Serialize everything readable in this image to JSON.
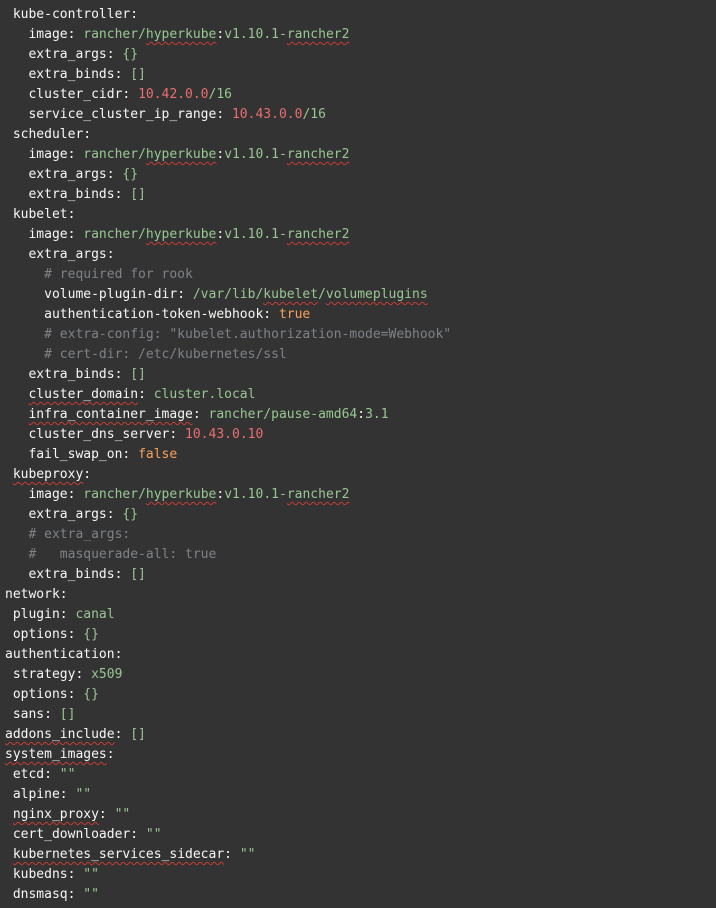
{
  "editor": {
    "language": "yaml",
    "content_description": "Rancher RKE cluster.yml services/network/authentication/system_images configuration",
    "colors": {
      "background": "#333333",
      "key_text": "#f7f7f5",
      "string_value": "#99C794",
      "number_value": "#EA6E71",
      "boolean_value": "#F9A15B",
      "comment": "#7E8288",
      "spellcheck_squiggle": "#c43c35"
    },
    "lines": [
      {
        "segments": [
          {
            "t": " kube-controller",
            "s": "key"
          },
          {
            "t": ":",
            "s": "pun"
          }
        ]
      },
      {
        "segments": [
          {
            "t": "   image",
            "s": "key"
          },
          {
            "t": ": ",
            "s": "pun"
          },
          {
            "t": "rancher/",
            "s": "str"
          },
          {
            "t": "hyperkube",
            "s": "str",
            "misspelled": true
          },
          {
            "t": ":",
            "s": "pun"
          },
          {
            "t": "v1.10.1-",
            "s": "str"
          },
          {
            "t": "rancher2",
            "s": "str",
            "misspelled": true
          }
        ]
      },
      {
        "segments": [
          {
            "t": "   extra_args",
            "s": "key"
          },
          {
            "t": ": ",
            "s": "pun"
          },
          {
            "t": "{}",
            "s": "str"
          }
        ]
      },
      {
        "segments": [
          {
            "t": "   extra_binds",
            "s": "key"
          },
          {
            "t": ": ",
            "s": "pun"
          },
          {
            "t": "[]",
            "s": "str"
          }
        ]
      },
      {
        "segments": [
          {
            "t": "   cluster_cidr",
            "s": "key"
          },
          {
            "t": ": ",
            "s": "pun"
          },
          {
            "t": "10.42.0.0",
            "s": "num"
          },
          {
            "t": "/16",
            "s": "str"
          }
        ]
      },
      {
        "segments": [
          {
            "t": "   service_cluster_ip_range",
            "s": "key"
          },
          {
            "t": ": ",
            "s": "pun"
          },
          {
            "t": "10.43.0.0",
            "s": "num"
          },
          {
            "t": "/16",
            "s": "str"
          }
        ]
      },
      {
        "segments": [
          {
            "t": " scheduler",
            "s": "key"
          },
          {
            "t": ":",
            "s": "pun"
          }
        ]
      },
      {
        "segments": [
          {
            "t": "   image",
            "s": "key"
          },
          {
            "t": ": ",
            "s": "pun"
          },
          {
            "t": "rancher/",
            "s": "str"
          },
          {
            "t": "hyperkube",
            "s": "str",
            "misspelled": true
          },
          {
            "t": ":",
            "s": "pun"
          },
          {
            "t": "v1.10.1-",
            "s": "str"
          },
          {
            "t": "rancher2",
            "s": "str",
            "misspelled": true
          }
        ]
      },
      {
        "segments": [
          {
            "t": "   extra_args",
            "s": "key"
          },
          {
            "t": ": ",
            "s": "pun"
          },
          {
            "t": "{}",
            "s": "str"
          }
        ]
      },
      {
        "segments": [
          {
            "t": "   extra_binds",
            "s": "key"
          },
          {
            "t": ": ",
            "s": "pun"
          },
          {
            "t": "[]",
            "s": "str"
          }
        ]
      },
      {
        "segments": [
          {
            "t": " kubelet",
            "s": "key"
          },
          {
            "t": ":",
            "s": "pun"
          }
        ]
      },
      {
        "segments": [
          {
            "t": "   image",
            "s": "key"
          },
          {
            "t": ": ",
            "s": "pun"
          },
          {
            "t": "rancher/",
            "s": "str"
          },
          {
            "t": "hyperkube",
            "s": "str",
            "misspelled": true
          },
          {
            "t": ":",
            "s": "pun"
          },
          {
            "t": "v1.10.1-",
            "s": "str"
          },
          {
            "t": "rancher2",
            "s": "str",
            "misspelled": true
          }
        ]
      },
      {
        "segments": [
          {
            "t": "   extra_args",
            "s": "key"
          },
          {
            "t": ":",
            "s": "pun"
          }
        ]
      },
      {
        "segments": [
          {
            "t": "     # required for rook",
            "s": "com"
          }
        ]
      },
      {
        "segments": [
          {
            "t": "     volume-plugin-dir",
            "s": "key"
          },
          {
            "t": ": ",
            "s": "pun"
          },
          {
            "t": "/var/lib/",
            "s": "str"
          },
          {
            "t": "kubelet",
            "s": "str",
            "misspelled": true
          },
          {
            "t": "/",
            "s": "str"
          },
          {
            "t": "volumeplugins",
            "s": "str",
            "misspelled": true
          }
        ]
      },
      {
        "segments": [
          {
            "t": "     authentication-token-webhook",
            "s": "key"
          },
          {
            "t": ": ",
            "s": "pun"
          },
          {
            "t": "true",
            "s": "bool"
          }
        ]
      },
      {
        "segments": [
          {
            "t": "     # extra-config: \"kubelet.authorization-mode=Webhook\"",
            "s": "com"
          }
        ]
      },
      {
        "segments": [
          {
            "t": "     # cert-dir: /etc/kubernetes/ssl",
            "s": "com"
          }
        ]
      },
      {
        "segments": [
          {
            "t": "   extra_binds",
            "s": "key"
          },
          {
            "t": ": ",
            "s": "pun"
          },
          {
            "t": "[]",
            "s": "str"
          }
        ]
      },
      {
        "segments": [
          {
            "t": "   ",
            "s": "pun"
          },
          {
            "t": "cluster_domain",
            "s": "key",
            "misspelled": true
          },
          {
            "t": ": ",
            "s": "pun"
          },
          {
            "t": "cluster.local",
            "s": "str"
          }
        ]
      },
      {
        "segments": [
          {
            "t": "   ",
            "s": "pun"
          },
          {
            "t": "infra_container_image",
            "s": "key",
            "misspelled": true
          },
          {
            "t": ": ",
            "s": "pun"
          },
          {
            "t": "rancher/pause-amd64",
            "s": "str"
          },
          {
            "t": ":",
            "s": "pun"
          },
          {
            "t": "3.1",
            "s": "str"
          }
        ]
      },
      {
        "segments": [
          {
            "t": "   cluster_dns_server",
            "s": "key"
          },
          {
            "t": ": ",
            "s": "pun"
          },
          {
            "t": "10.43.0.10",
            "s": "num"
          }
        ]
      },
      {
        "segments": [
          {
            "t": "   fail_swap_on",
            "s": "key"
          },
          {
            "t": ": ",
            "s": "pun"
          },
          {
            "t": "false",
            "s": "bool"
          }
        ]
      },
      {
        "segments": [
          {
            "t": " ",
            "s": "pun"
          },
          {
            "t": "kubeproxy",
            "s": "key",
            "misspelled": true
          },
          {
            "t": ":",
            "s": "pun"
          }
        ]
      },
      {
        "segments": [
          {
            "t": "   image",
            "s": "key"
          },
          {
            "t": ": ",
            "s": "pun"
          },
          {
            "t": "rancher/",
            "s": "str"
          },
          {
            "t": "hyperkube",
            "s": "str",
            "misspelled": true
          },
          {
            "t": ":",
            "s": "pun"
          },
          {
            "t": "v1.10.1-",
            "s": "str"
          },
          {
            "t": "rancher2",
            "s": "str",
            "misspelled": true
          }
        ]
      },
      {
        "segments": [
          {
            "t": "   extra_args",
            "s": "key"
          },
          {
            "t": ": ",
            "s": "pun"
          },
          {
            "t": "{}",
            "s": "str"
          }
        ]
      },
      {
        "segments": [
          {
            "t": "   # extra_args:",
            "s": "com"
          }
        ]
      },
      {
        "segments": [
          {
            "t": "   #   masquerade-all: true",
            "s": "com"
          }
        ]
      },
      {
        "segments": [
          {
            "t": "   extra_binds",
            "s": "key"
          },
          {
            "t": ": ",
            "s": "pun"
          },
          {
            "t": "[]",
            "s": "str"
          }
        ]
      },
      {
        "segments": [
          {
            "t": "network",
            "s": "key"
          },
          {
            "t": ":",
            "s": "pun"
          }
        ]
      },
      {
        "segments": [
          {
            "t": " plugin",
            "s": "key"
          },
          {
            "t": ": ",
            "s": "pun"
          },
          {
            "t": "canal",
            "s": "str"
          }
        ]
      },
      {
        "segments": [
          {
            "t": " options",
            "s": "key"
          },
          {
            "t": ": ",
            "s": "pun"
          },
          {
            "t": "{}",
            "s": "str"
          }
        ]
      },
      {
        "segments": [
          {
            "t": "authentication",
            "s": "key"
          },
          {
            "t": ":",
            "s": "pun"
          }
        ]
      },
      {
        "segments": [
          {
            "t": " strategy",
            "s": "key"
          },
          {
            "t": ": ",
            "s": "pun"
          },
          {
            "t": "x509",
            "s": "str"
          }
        ]
      },
      {
        "segments": [
          {
            "t": " options",
            "s": "key"
          },
          {
            "t": ": ",
            "s": "pun"
          },
          {
            "t": "{}",
            "s": "str"
          }
        ]
      },
      {
        "segments": [
          {
            "t": " sans",
            "s": "key"
          },
          {
            "t": ": ",
            "s": "pun"
          },
          {
            "t": "[]",
            "s": "str"
          }
        ]
      },
      {
        "segments": [
          {
            "t": "addons_include",
            "s": "key",
            "misspelled": true
          },
          {
            "t": ": ",
            "s": "pun"
          },
          {
            "t": "[]",
            "s": "str"
          }
        ]
      },
      {
        "segments": [
          {
            "t": "system_images",
            "s": "key",
            "misspelled": true
          },
          {
            "t": ":",
            "s": "pun"
          }
        ]
      },
      {
        "segments": [
          {
            "t": " etcd",
            "s": "key"
          },
          {
            "t": ": ",
            "s": "pun"
          },
          {
            "t": "\"\"",
            "s": "str"
          }
        ]
      },
      {
        "segments": [
          {
            "t": " alpine",
            "s": "key"
          },
          {
            "t": ": ",
            "s": "pun"
          },
          {
            "t": "\"\"",
            "s": "str"
          }
        ]
      },
      {
        "segments": [
          {
            "t": " ",
            "s": "pun"
          },
          {
            "t": "nginx_proxy",
            "s": "key",
            "misspelled": true
          },
          {
            "t": ": ",
            "s": "pun"
          },
          {
            "t": "\"\"",
            "s": "str"
          }
        ]
      },
      {
        "segments": [
          {
            "t": " cert_downloader",
            "s": "key"
          },
          {
            "t": ": ",
            "s": "pun"
          },
          {
            "t": "\"\"",
            "s": "str"
          }
        ]
      },
      {
        "segments": [
          {
            "t": " ",
            "s": "pun"
          },
          {
            "t": "kubernetes_services_sidecar",
            "s": "key",
            "misspelled": true
          },
          {
            "t": ": ",
            "s": "pun"
          },
          {
            "t": "\"\"",
            "s": "str"
          }
        ]
      },
      {
        "segments": [
          {
            "t": " kubedns",
            "s": "key"
          },
          {
            "t": ": ",
            "s": "pun"
          },
          {
            "t": "\"\"",
            "s": "str"
          }
        ]
      },
      {
        "segments": [
          {
            "t": " dnsmasq",
            "s": "key"
          },
          {
            "t": ": ",
            "s": "pun"
          },
          {
            "t": "\"\"",
            "s": "str"
          }
        ]
      }
    ]
  }
}
